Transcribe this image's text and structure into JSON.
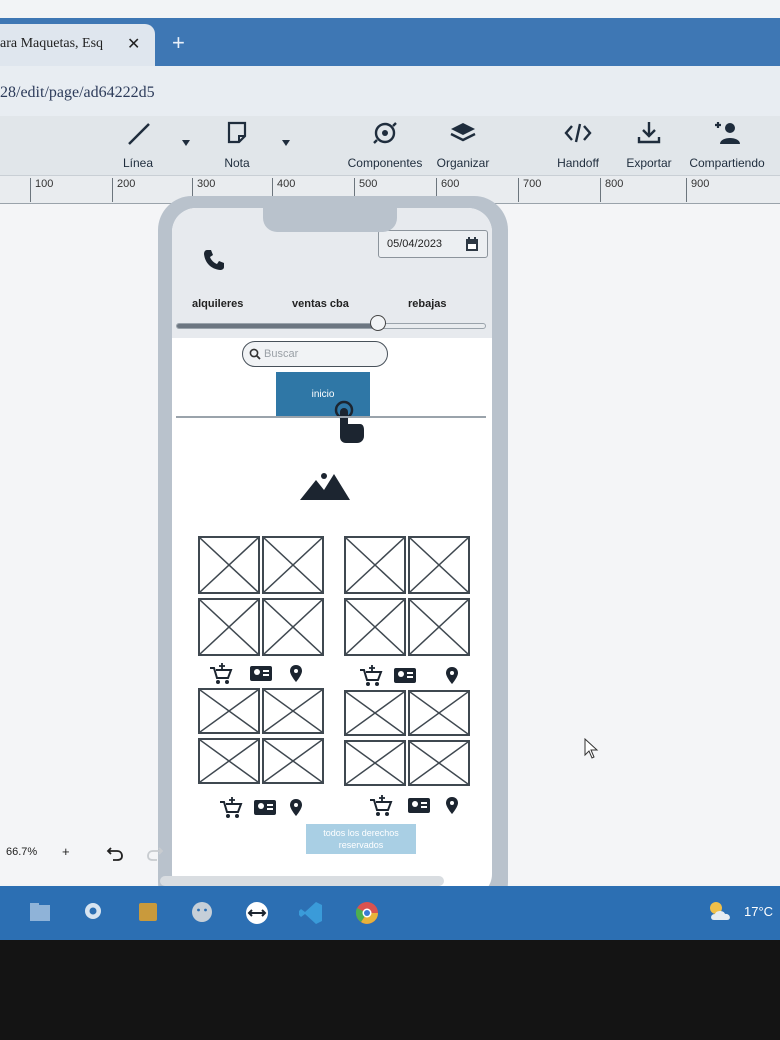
{
  "browser": {
    "tab_title": "ara Maquetas, Esq",
    "tab_close": "✕",
    "new_tab": "+",
    "url": "28/edit/page/ad64222d5"
  },
  "toolbar": {
    "tools": [
      {
        "label": "Línea",
        "icon": "line-icon"
      },
      {
        "label": "Nota",
        "icon": "note-icon"
      },
      {
        "label": "Componentes",
        "icon": "components-icon"
      },
      {
        "label": "Organizar",
        "icon": "layers-icon"
      },
      {
        "label": "Handoff",
        "icon": "code-icon"
      },
      {
        "label": "Exportar",
        "icon": "download-icon"
      },
      {
        "label": "Compartiendo",
        "icon": "add-user-icon"
      }
    ]
  },
  "ruler": {
    "marks": [
      "100",
      "200",
      "300",
      "400",
      "500",
      "600",
      "700",
      "800",
      "900"
    ]
  },
  "phone": {
    "date": "05/04/2023",
    "tabs": [
      "alquileres",
      "ventas cba",
      "rebajas"
    ],
    "slider_value": 0.65,
    "search_placeholder": "Buscar",
    "button_label": "inicio",
    "footer_text": "todos los derechos reservados"
  },
  "status": {
    "zoom": "66.7%",
    "zoom_plus": "+"
  },
  "taskbar": {
    "icons": [
      "file-explorer-icon",
      "settings-icon",
      "files-icon",
      "emoji-icon",
      "remote-icon",
      "vscode-icon",
      "chrome-icon"
    ],
    "temperature": "17°C"
  },
  "colors": {
    "accent": "#2f77a6",
    "taskbar": "#2c6fb3",
    "footer": "#a9cfe4"
  }
}
